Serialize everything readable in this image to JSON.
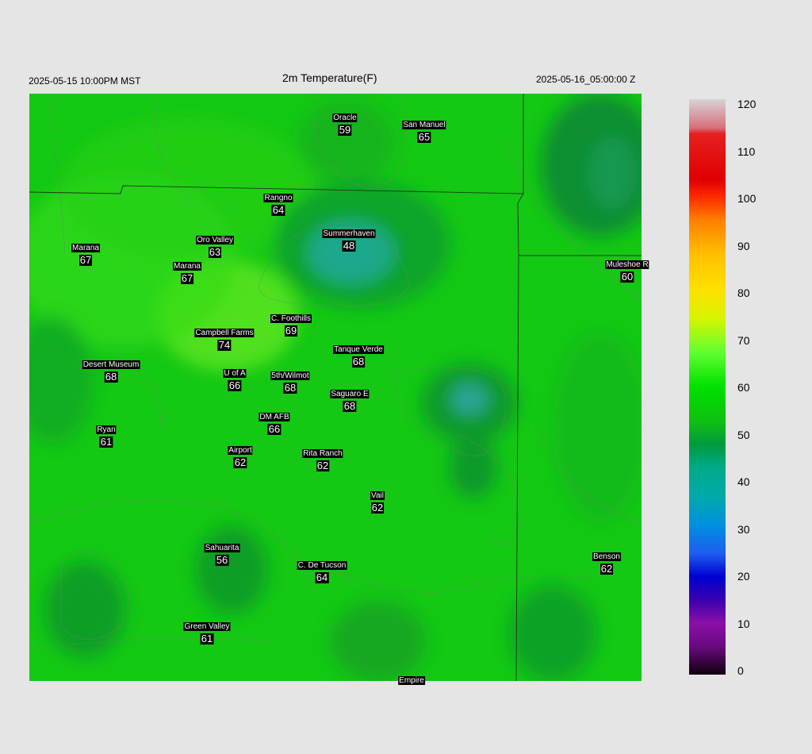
{
  "header": {
    "local_time": "2025-05-15 10:00PM MST",
    "title": "2m Temperature(F)",
    "utc_time": "2025-05-16_05:00:00 Z"
  },
  "stations": [
    {
      "name": "Oracle",
      "value": "59"
    },
    {
      "name": "San Manuel",
      "value": "65"
    },
    {
      "name": "Rangno",
      "value": "64"
    },
    {
      "name": "Summerhaven",
      "value": "48"
    },
    {
      "name": "Marana",
      "value": "67"
    },
    {
      "name": "Oro Valley",
      "value": "63"
    },
    {
      "name": "Marana",
      "value": "67"
    },
    {
      "name": "Muleshoe R",
      "value": "60"
    },
    {
      "name": "C. Foothills",
      "value": "69"
    },
    {
      "name": "Campbell Farms",
      "value": "74"
    },
    {
      "name": "Tanque Verde",
      "value": "68"
    },
    {
      "name": "Desert Museum",
      "value": "68"
    },
    {
      "name": "U of A",
      "value": "66"
    },
    {
      "name": "5th/Wilmot",
      "value": "68"
    },
    {
      "name": "Saguaro E",
      "value": "68"
    },
    {
      "name": "DM AFB",
      "value": "66"
    },
    {
      "name": "Ryan",
      "value": "61"
    },
    {
      "name": "Airport",
      "value": "62"
    },
    {
      "name": "Rita Ranch",
      "value": "62"
    },
    {
      "name": "Vail",
      "value": "62"
    },
    {
      "name": "Sahuarita",
      "value": "56"
    },
    {
      "name": "C. De Tucson",
      "value": "64"
    },
    {
      "name": "Benson",
      "value": "62"
    },
    {
      "name": "Green Valley",
      "value": "61"
    },
    {
      "name": "Empire",
      "value": ""
    }
  ],
  "colorbar": {
    "ticks": [
      "120",
      "110",
      "100",
      "90",
      "80",
      "70",
      "60",
      "50",
      "40",
      "30",
      "20",
      "10",
      "0"
    ],
    "min": 0,
    "max": 120
  }
}
